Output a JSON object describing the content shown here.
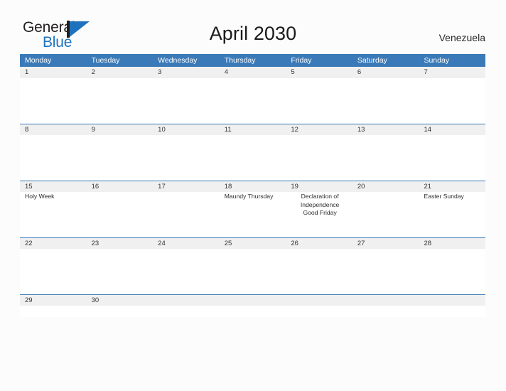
{
  "branding": {
    "name_primary": "General",
    "name_secondary": "Blue",
    "mark": "triangle-flag-icon"
  },
  "header": {
    "title": "April 2030",
    "locale": "Venezuela"
  },
  "colors": {
    "header_blue": "#3a7ab8",
    "logo_blue": "#1f73be",
    "date_band": "#f0f0f0",
    "page_background": "#fcfcfc",
    "text": "#2b2b2b"
  },
  "calendar": {
    "month": "April",
    "year": "2030",
    "weekday_headers": [
      "Monday",
      "Tuesday",
      "Wednesday",
      "Thursday",
      "Friday",
      "Saturday",
      "Sunday"
    ],
    "weeks": [
      {
        "days": [
          {
            "date": "1",
            "events": []
          },
          {
            "date": "2",
            "events": []
          },
          {
            "date": "3",
            "events": []
          },
          {
            "date": "4",
            "events": []
          },
          {
            "date": "5",
            "events": []
          },
          {
            "date": "6",
            "events": []
          },
          {
            "date": "7",
            "events": []
          }
        ]
      },
      {
        "days": [
          {
            "date": "8",
            "events": []
          },
          {
            "date": "9",
            "events": []
          },
          {
            "date": "10",
            "events": []
          },
          {
            "date": "11",
            "events": []
          },
          {
            "date": "12",
            "events": []
          },
          {
            "date": "13",
            "events": []
          },
          {
            "date": "14",
            "events": []
          }
        ]
      },
      {
        "days": [
          {
            "date": "15",
            "events": [
              "Holy Week"
            ]
          },
          {
            "date": "16",
            "events": []
          },
          {
            "date": "17",
            "events": []
          },
          {
            "date": "18",
            "events": [
              "Maundy Thursday"
            ]
          },
          {
            "date": "19",
            "events": [
              "Declaration of Independence",
              "Good Friday"
            ]
          },
          {
            "date": "20",
            "events": []
          },
          {
            "date": "21",
            "events": [
              "Easter Sunday"
            ]
          }
        ]
      },
      {
        "days": [
          {
            "date": "22",
            "events": []
          },
          {
            "date": "23",
            "events": []
          },
          {
            "date": "24",
            "events": []
          },
          {
            "date": "25",
            "events": []
          },
          {
            "date": "26",
            "events": []
          },
          {
            "date": "27",
            "events": []
          },
          {
            "date": "28",
            "events": []
          }
        ]
      },
      {
        "days": [
          {
            "date": "29",
            "events": []
          },
          {
            "date": "30",
            "events": []
          },
          {
            "date": "",
            "events": []
          },
          {
            "date": "",
            "events": []
          },
          {
            "date": "",
            "events": []
          },
          {
            "date": "",
            "events": []
          },
          {
            "date": "",
            "events": []
          }
        ]
      }
    ]
  }
}
